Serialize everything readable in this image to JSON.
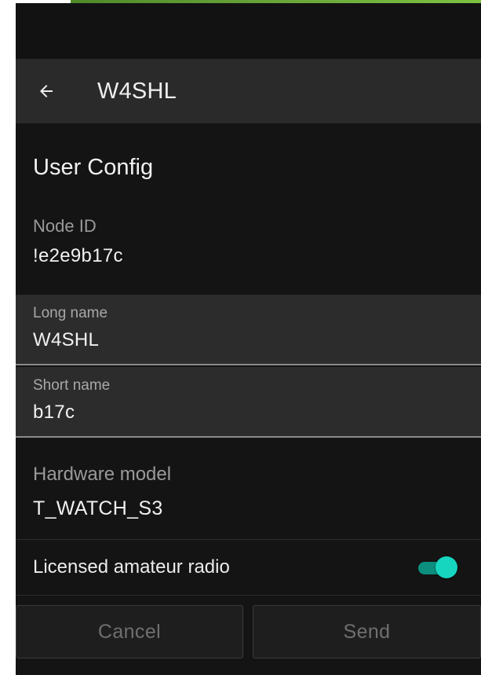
{
  "app_bar": {
    "title": "W4SHL",
    "back_icon": "arrow-left-icon"
  },
  "section": {
    "title": "User Config"
  },
  "node_id": {
    "label": "Node ID",
    "value": "!e2e9b17c"
  },
  "long_name": {
    "label": "Long name",
    "value": "W4SHL"
  },
  "short_name": {
    "label": "Short name",
    "value": "b17c"
  },
  "hardware_model": {
    "label": "Hardware model",
    "value": "T_WATCH_S3"
  },
  "licensed_amateur_radio": {
    "label": "Licensed amateur radio",
    "enabled": true
  },
  "actions": {
    "cancel_label": "Cancel",
    "send_label": "Send"
  },
  "colors": {
    "background": "#141414",
    "app_bar": "#2a2a2a",
    "input_fill": "#2c2c2c",
    "switch_thumb": "#16d6c0",
    "switch_track": "#0c8f7e",
    "decoration_green": "#6aa83a"
  }
}
